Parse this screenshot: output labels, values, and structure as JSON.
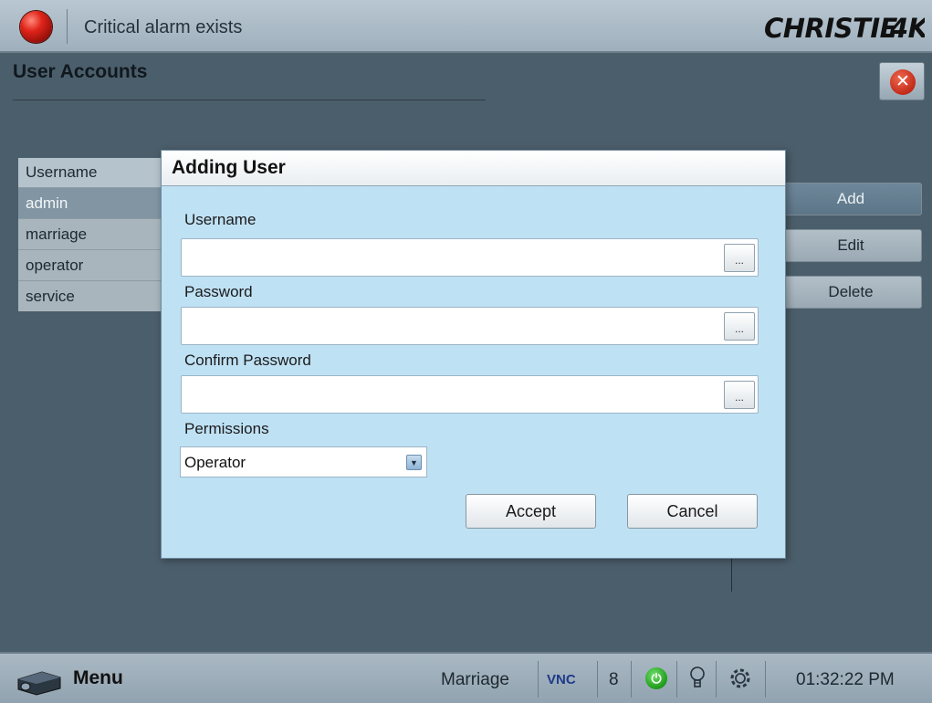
{
  "top_bar": {
    "alarm_text": "Critical alarm exists",
    "brand": "CHRISTIE 4K"
  },
  "page": {
    "title": "User Accounts"
  },
  "user_table": {
    "header": "Username",
    "rows": [
      "admin",
      "marriage",
      "operator",
      "service"
    ],
    "selected_index": 0
  },
  "side_buttons": {
    "add": "Add",
    "edit": "Edit",
    "delete": "Delete"
  },
  "dialog": {
    "title": "Adding User",
    "username_label": "Username",
    "username_value": "",
    "password_label": "Password",
    "password_value": "",
    "confirm_label": "Confirm Password",
    "confirm_value": "",
    "browse_label": "...",
    "permissions_label": "Permissions",
    "permissions_value": "Operator",
    "accept": "Accept",
    "cancel": "Cancel"
  },
  "bottom_bar": {
    "menu_label": "Menu",
    "user_name": "Marriage",
    "vnc_label": "VNC",
    "count": "8",
    "time": "01:32:22 PM"
  },
  "colors": {
    "alarm": "#e0241a",
    "background": "#4b5e6b",
    "dialog": "#bfe1f4",
    "power_ok": "#1f9b1a"
  },
  "icons": [
    "alarm-led-icon",
    "close-icon",
    "projector-icon",
    "power-icon",
    "lamp-icon",
    "gear-icon",
    "dropdown-arrow-icon"
  ]
}
